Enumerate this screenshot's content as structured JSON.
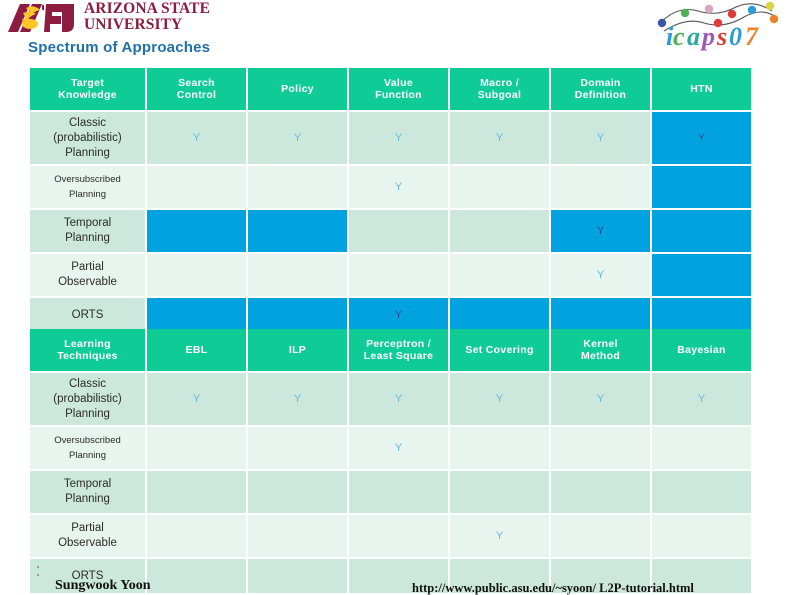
{
  "branding": {
    "asu_mark": "asu-pitchfork-logo",
    "asu_line1": "ARIZONA STATE",
    "asu_line2": "UNIVERSITY",
    "icaps_logo": "icaps-2007-logo"
  },
  "slide": {
    "title": "Spectrum of Approaches"
  },
  "colors": {
    "header_green": "#0FCC97",
    "row_odd": "#CCE8DC",
    "row_even": "#E8F4EE",
    "highlight_blue": "#00A3E0",
    "mark_blue": "#63B9E0",
    "mark_dark": "#2B4C8C",
    "title_blue": "#1F6FA8",
    "asu_maroon": "#8C1D40",
    "asu_gold": "#FFC627"
  },
  "table1": {
    "headers": [
      "Target\nKnowledge",
      "Search\nControl",
      "Policy",
      "Value\nFunction",
      "Macro /\nSubgoal",
      "Domain\nDefinition",
      "HTN"
    ],
    "headers_flat": [
      "Target Knowledge",
      "Search Control",
      "Policy",
      "Value Function",
      "Macro / Subgoal",
      "Domain Definition",
      "HTN"
    ],
    "rows": [
      {
        "label": "Classic\n(probabilistic)\nPlanning",
        "label_flat": "Classic (probabilistic) Planning",
        "cells": [
          {
            "mark": "Y",
            "hi": false
          },
          {
            "mark": "Y",
            "hi": false
          },
          {
            "mark": "Y",
            "hi": false
          },
          {
            "mark": "Y",
            "hi": false
          },
          {
            "mark": "Y",
            "hi": false
          },
          {
            "mark": "Y",
            "hi": true
          }
        ]
      },
      {
        "label": "Oversubscribed\nPlanning",
        "label_flat": "Oversubscribed Planning",
        "cells": [
          {
            "mark": "",
            "hi": false
          },
          {
            "mark": "",
            "hi": false
          },
          {
            "mark": "Y",
            "hi": false
          },
          {
            "mark": "",
            "hi": false
          },
          {
            "mark": "",
            "hi": false
          },
          {
            "mark": "",
            "hi": true
          }
        ]
      },
      {
        "label": "Temporal\nPlanning",
        "label_flat": "Temporal Planning",
        "cells": [
          {
            "mark": "",
            "hi": true
          },
          {
            "mark": "",
            "hi": true
          },
          {
            "mark": "",
            "hi": false
          },
          {
            "mark": "",
            "hi": false
          },
          {
            "mark": "Y",
            "hi": true
          },
          {
            "mark": "",
            "hi": true
          }
        ]
      },
      {
        "label": "Partial\nObservable",
        "label_flat": "Partial Observable",
        "cells": [
          {
            "mark": "",
            "hi": false
          },
          {
            "mark": "",
            "hi": false
          },
          {
            "mark": "",
            "hi": false
          },
          {
            "mark": "",
            "hi": false
          },
          {
            "mark": "Y",
            "hi": false
          },
          {
            "mark": "",
            "hi": true
          }
        ]
      },
      {
        "label": "ORTS",
        "label_flat": "ORTS",
        "cells": [
          {
            "mark": "",
            "hi": true
          },
          {
            "mark": "",
            "hi": true
          },
          {
            "mark": "Y",
            "hi": true
          },
          {
            "mark": "",
            "hi": true
          },
          {
            "mark": "",
            "hi": true
          },
          {
            "mark": "",
            "hi": true
          }
        ]
      }
    ]
  },
  "table2": {
    "headers": [
      "Learning\nTechniques",
      "EBL",
      "ILP",
      "Perceptron /\nLeast Square",
      "Set Covering",
      "Kernel\nMethod",
      "Bayesian"
    ],
    "headers_flat": [
      "Learning Techniques",
      "EBL",
      "ILP",
      "Perceptron / Least Square",
      "Set Covering",
      "Kernel Method",
      "Bayesian"
    ],
    "rows": [
      {
        "label": "Classic\n(probabilistic)\nPlanning",
        "label_flat": "Classic (probabilistic) Planning",
        "cells": [
          {
            "mark": "Y",
            "hi": false
          },
          {
            "mark": "Y",
            "hi": false
          },
          {
            "mark": "Y",
            "hi": false
          },
          {
            "mark": "Y",
            "hi": false
          },
          {
            "mark": "Y",
            "hi": false
          },
          {
            "mark": "Y",
            "hi": false
          }
        ]
      },
      {
        "label": "Oversubscribed\nPlanning",
        "label_flat": "Oversubscribed Planning",
        "cells": [
          {
            "mark": "",
            "hi": false
          },
          {
            "mark": "",
            "hi": false
          },
          {
            "mark": "Y",
            "hi": false
          },
          {
            "mark": "",
            "hi": false
          },
          {
            "mark": "",
            "hi": false
          },
          {
            "mark": "",
            "hi": false
          }
        ]
      },
      {
        "label": "Temporal\nPlanning",
        "label_flat": "Temporal Planning",
        "cells": [
          {
            "mark": "",
            "hi": false
          },
          {
            "mark": "",
            "hi": false
          },
          {
            "mark": "",
            "hi": false
          },
          {
            "mark": "",
            "hi": false
          },
          {
            "mark": "",
            "hi": false
          },
          {
            "mark": "",
            "hi": false
          }
        ]
      },
      {
        "label": "Partial\nObservable",
        "label_flat": "Partial Observable",
        "cells": [
          {
            "mark": "",
            "hi": false
          },
          {
            "mark": "",
            "hi": false
          },
          {
            "mark": "",
            "hi": false
          },
          {
            "mark": "Y",
            "hi": false
          },
          {
            "mark": "",
            "hi": false
          },
          {
            "mark": "",
            "hi": false
          }
        ]
      },
      {
        "label": "ORTS",
        "label_flat": "ORTS",
        "cells": [
          {
            "mark": "",
            "hi": false
          },
          {
            "mark": "",
            "hi": false
          },
          {
            "mark": "",
            "hi": false
          },
          {
            "mark": "",
            "hi": false
          },
          {
            "mark": "",
            "hi": false
          },
          {
            "mark": "",
            "hi": false
          }
        ]
      }
    ]
  },
  "footer": {
    "author": "Sungwook Yoon",
    "url": "http://www.public.asu.edu/~syoon/ L2P-tutorial.html"
  }
}
